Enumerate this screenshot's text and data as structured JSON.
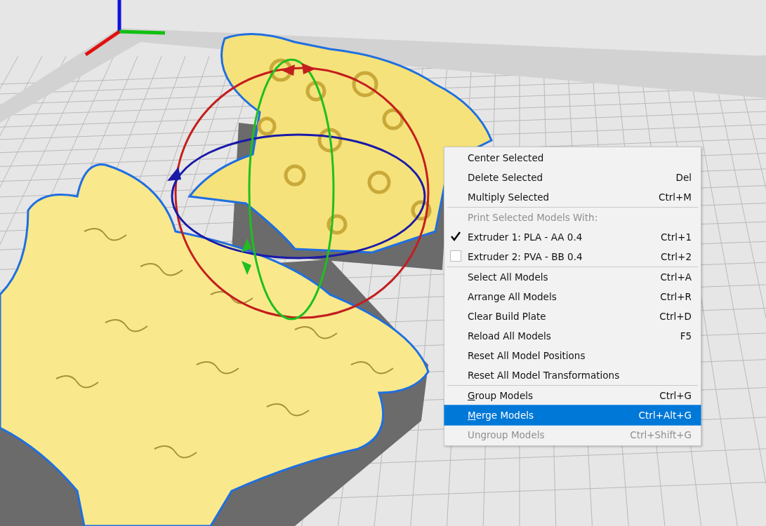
{
  "context_menu": {
    "sections": [
      [
        {
          "kind": "action",
          "label": "Center Selected",
          "disabled": false,
          "selected": false
        },
        {
          "kind": "action",
          "label": "Delete Selected",
          "shortcut": "Del",
          "disabled": false,
          "selected": false
        },
        {
          "kind": "action",
          "label": "Multiply Selected",
          "shortcut": "Ctrl+M",
          "disabled": false,
          "selected": false
        }
      ],
      [
        {
          "kind": "header",
          "label": "Print Selected Models With:"
        },
        {
          "kind": "check",
          "label": "Extruder 1: PLA - AA 0.4",
          "shortcut": "Ctrl+1",
          "checked": true,
          "disabled": false,
          "selected": false
        },
        {
          "kind": "check",
          "label": "Extruder 2: PVA - BB 0.4",
          "shortcut": "Ctrl+2",
          "checked": false,
          "disabled": false,
          "selected": false
        }
      ],
      [
        {
          "kind": "action",
          "label": "Select All Models",
          "shortcut": "Ctrl+A",
          "disabled": false,
          "selected": false
        },
        {
          "kind": "action",
          "label": "Arrange All Models",
          "shortcut": "Ctrl+R",
          "disabled": false,
          "selected": false
        },
        {
          "kind": "action",
          "label": "Clear Build Plate",
          "shortcut": "Ctrl+D",
          "disabled": false,
          "selected": false
        },
        {
          "kind": "action",
          "label": "Reload All Models",
          "shortcut": "F5",
          "disabled": false,
          "selected": false
        },
        {
          "kind": "action",
          "label": "Reset All Model Positions",
          "disabled": false,
          "selected": false
        },
        {
          "kind": "action",
          "label": "Reset All Model Transformations",
          "disabled": false,
          "selected": false
        }
      ],
      [
        {
          "kind": "action",
          "label": "Group Models",
          "shortcut": "Ctrl+G",
          "underline_first": true,
          "disabled": false,
          "selected": false
        },
        {
          "kind": "action",
          "label": "Merge Models",
          "shortcut": "Ctrl+Alt+G",
          "underline_first": true,
          "disabled": false,
          "selected": true
        },
        {
          "kind": "action",
          "label": "Ungroup Models",
          "shortcut": "Ctrl+Shift+G",
          "disabled": true,
          "selected": false
        }
      ]
    ]
  }
}
